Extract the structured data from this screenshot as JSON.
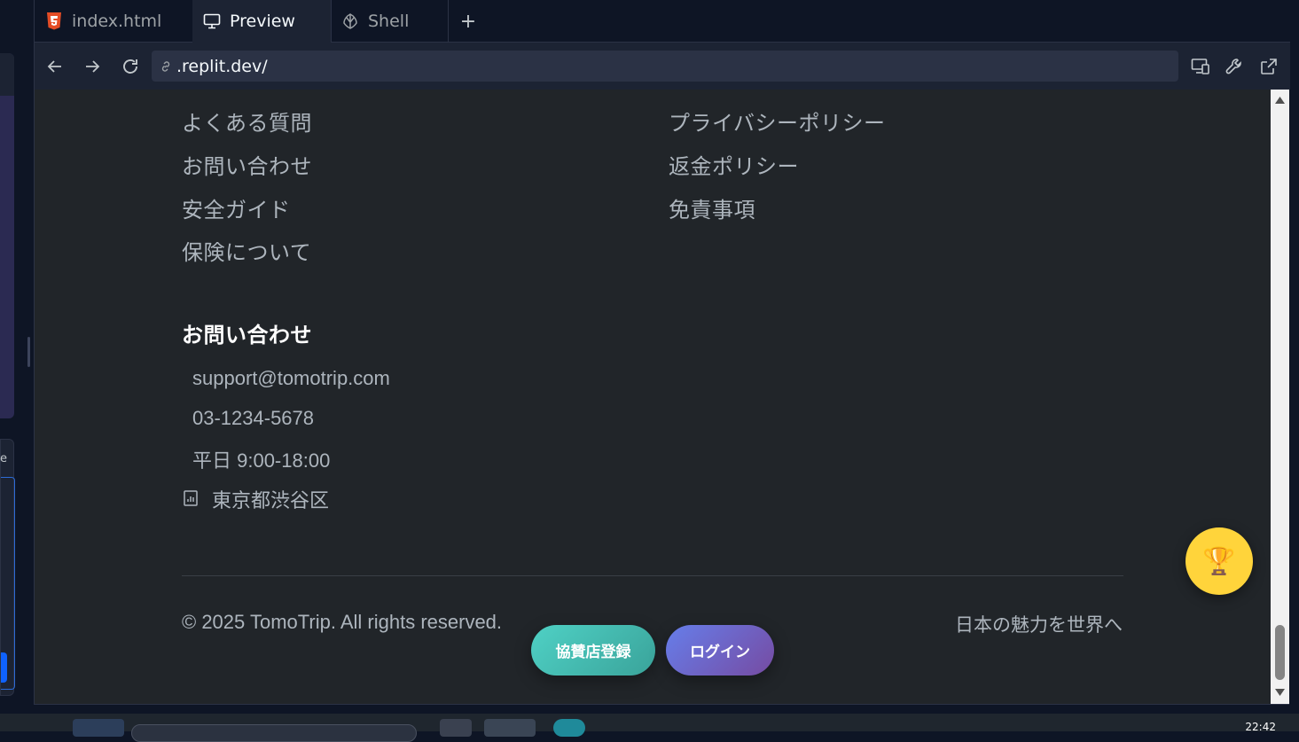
{
  "tabs": [
    {
      "label": "index.html",
      "icon": "html5-icon"
    },
    {
      "label": "Preview",
      "icon": "monitor-icon",
      "active": true
    },
    {
      "label": "Shell",
      "icon": "shell-icon"
    }
  ],
  "new_tab_symbol": "+",
  "url": ".replit.dev/",
  "page": {
    "links_left": [
      "よくある質問",
      "お問い合わせ",
      "安全ガイド",
      "保険について"
    ],
    "links_right": [
      "プライバシーポリシー",
      "返金ポリシー",
      "免責事項"
    ],
    "contact_title": "お問い合わせ",
    "contact": {
      "email": "support@tomotrip.com",
      "phone": "03-1234-5678",
      "hours": "平日 9:00-18:00",
      "address": "東京都渋谷区"
    },
    "copyright": "© 2025 TomoTrip. All rights reserved.",
    "tagline": "日本の魅力を世界へ",
    "sponsor_button": "協賛店登録",
    "login_button": "ログイン",
    "fab_icon": "🏆"
  },
  "left_glyph": "e",
  "taskbar_clock": "22:42",
  "colors": {
    "sponsor_gradient": [
      "#4fd1c5",
      "#3aa39a"
    ],
    "login_gradient": [
      "#667eea",
      "#764ba2"
    ],
    "fab": "#ffd43b",
    "page_bg": "#212529"
  }
}
